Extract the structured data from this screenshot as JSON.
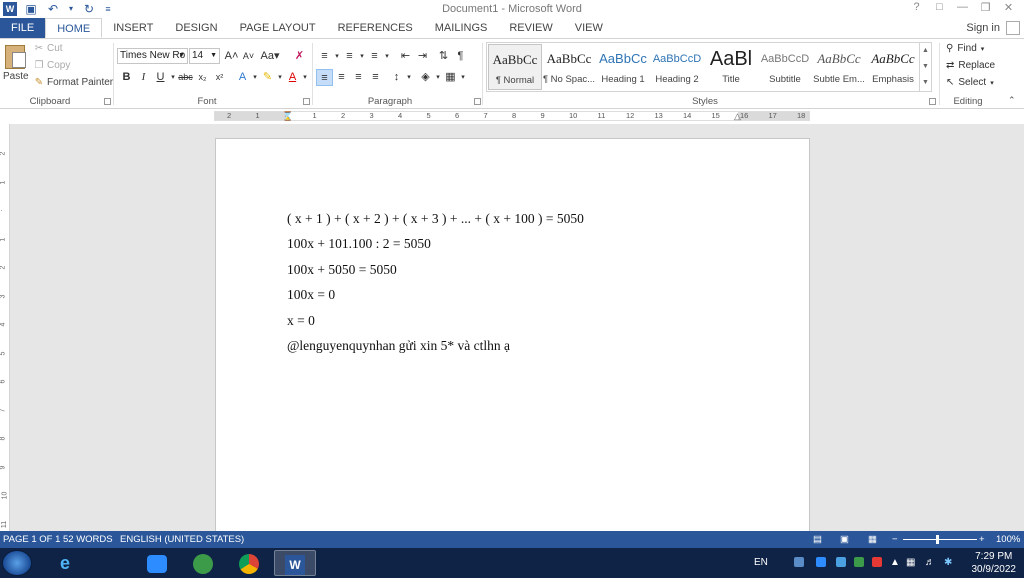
{
  "window": {
    "title": "Document1 - Microsoft Word",
    "help": "?",
    "signin": "Sign in"
  },
  "ribbon_tabs": [
    "FILE",
    "HOME",
    "INSERT",
    "DESIGN",
    "PAGE LAYOUT",
    "REFERENCES",
    "MAILINGS",
    "REVIEW",
    "VIEW"
  ],
  "active_tab": "HOME",
  "clipboard": {
    "paste": "Paste",
    "cut": "Cut",
    "copy": "Copy",
    "format_painter": "Format Painter",
    "label": "Clipboard"
  },
  "font": {
    "family": "Times New Ro",
    "size": "14",
    "label": "Font"
  },
  "paragraph": {
    "label": "Paragraph"
  },
  "styles": {
    "label": "Styles",
    "items": [
      {
        "preview": "AaBbCc",
        "name": "¶ Normal"
      },
      {
        "preview": "AaBbCc",
        "name": "¶ No Spac..."
      },
      {
        "preview": "AaBbCc",
        "name": "Heading 1"
      },
      {
        "preview": "AaBbCcD",
        "name": "Heading 2"
      },
      {
        "preview": "AaBl",
        "name": "Title"
      },
      {
        "preview": "AaBbCcD",
        "name": "Subtitle"
      },
      {
        "preview": "AaBbCc",
        "name": "Subtle Em..."
      },
      {
        "preview": "AaBbCc",
        "name": "Emphasis"
      }
    ]
  },
  "editing": {
    "find": "Find",
    "replace": "Replace",
    "select": "Select",
    "label": "Editing"
  },
  "ruler": {
    "ticks": [
      "2",
      "1",
      "",
      "1",
      "2",
      "3",
      "4",
      "5",
      "6",
      "7",
      "8",
      "9",
      "10",
      "11",
      "12",
      "13",
      "14",
      "15",
      "16",
      "17",
      "18"
    ]
  },
  "vruler": {
    "ticks": [
      "2",
      "1",
      "",
      "1",
      "2",
      "3",
      "4",
      "5",
      "6",
      "7",
      "8",
      "9",
      "10",
      "11"
    ]
  },
  "document": {
    "lines": [
      "( x + 1 ) + ( x + 2 ) + ( x + 3 ) + ... + ( x + 100 ) = 5050",
      "100x + 101.100 : 2 = 5050",
      "100x + 5050 = 5050",
      "100x = 0",
      "x = 0",
      "@lenguyenquynhan gửi xin 5* và ctlhn ạ"
    ]
  },
  "status": {
    "page": "PAGE 1 OF 1",
    "words": "52 WORDS",
    "language": "ENGLISH (UNITED STATES)",
    "zoom": "100%",
    "zoom_fraction": 0.45
  },
  "taskbar": {
    "language": "EN",
    "time": "7:29 PM",
    "date": "30/9/2022"
  },
  "colors": {
    "accent": "#2b579a",
    "taskbar": "#0f2346",
    "workspace": "#e6e6e6"
  }
}
